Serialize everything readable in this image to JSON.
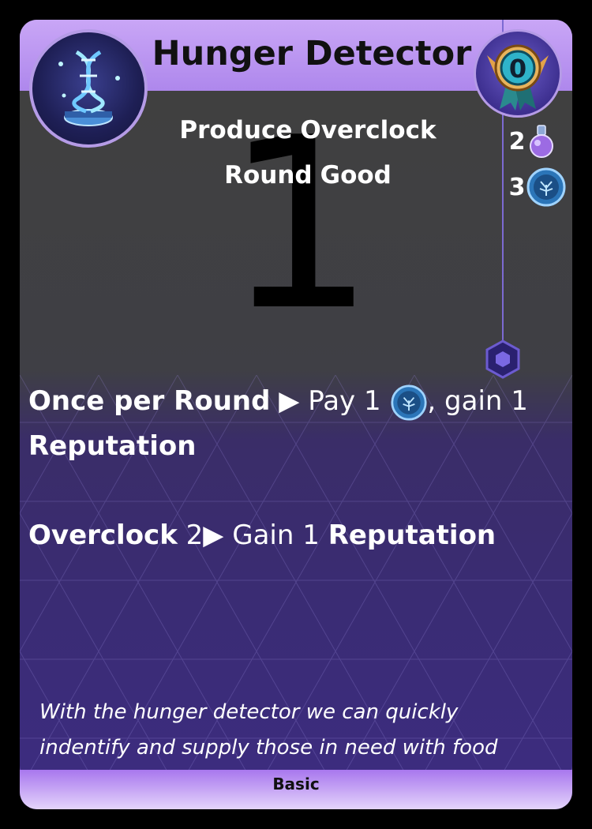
{
  "card": {
    "title": "Hunger Detector",
    "main_icon": "dna-icon",
    "badge_value": "0",
    "big_number": "1",
    "tags": [
      "Produce",
      "Overclock",
      "Round",
      "Good"
    ],
    "costs": [
      {
        "amount": "2",
        "icon": "potion-icon"
      },
      {
        "amount": "3",
        "icon": "tree-token-icon"
      }
    ],
    "ability1": {
      "trigger": "Once per Round",
      "text_a": "Pay 1",
      "text_b": ", gain 1",
      "bold_end": "Reputation",
      "icon": "tree-token-icon"
    },
    "ability2": {
      "trigger": "Overclock",
      "value": "2",
      "text": "Gain 1",
      "bold_end": "Reputation"
    },
    "flavor_line1": "With the hunger detector we can quickly",
    "flavor_line2": "indentify and supply those in need with food",
    "rarity": "Basic"
  },
  "colors": {
    "accent": "#a57de9",
    "panel_dark": "#404040",
    "panel_purple": "#3a2c72"
  }
}
